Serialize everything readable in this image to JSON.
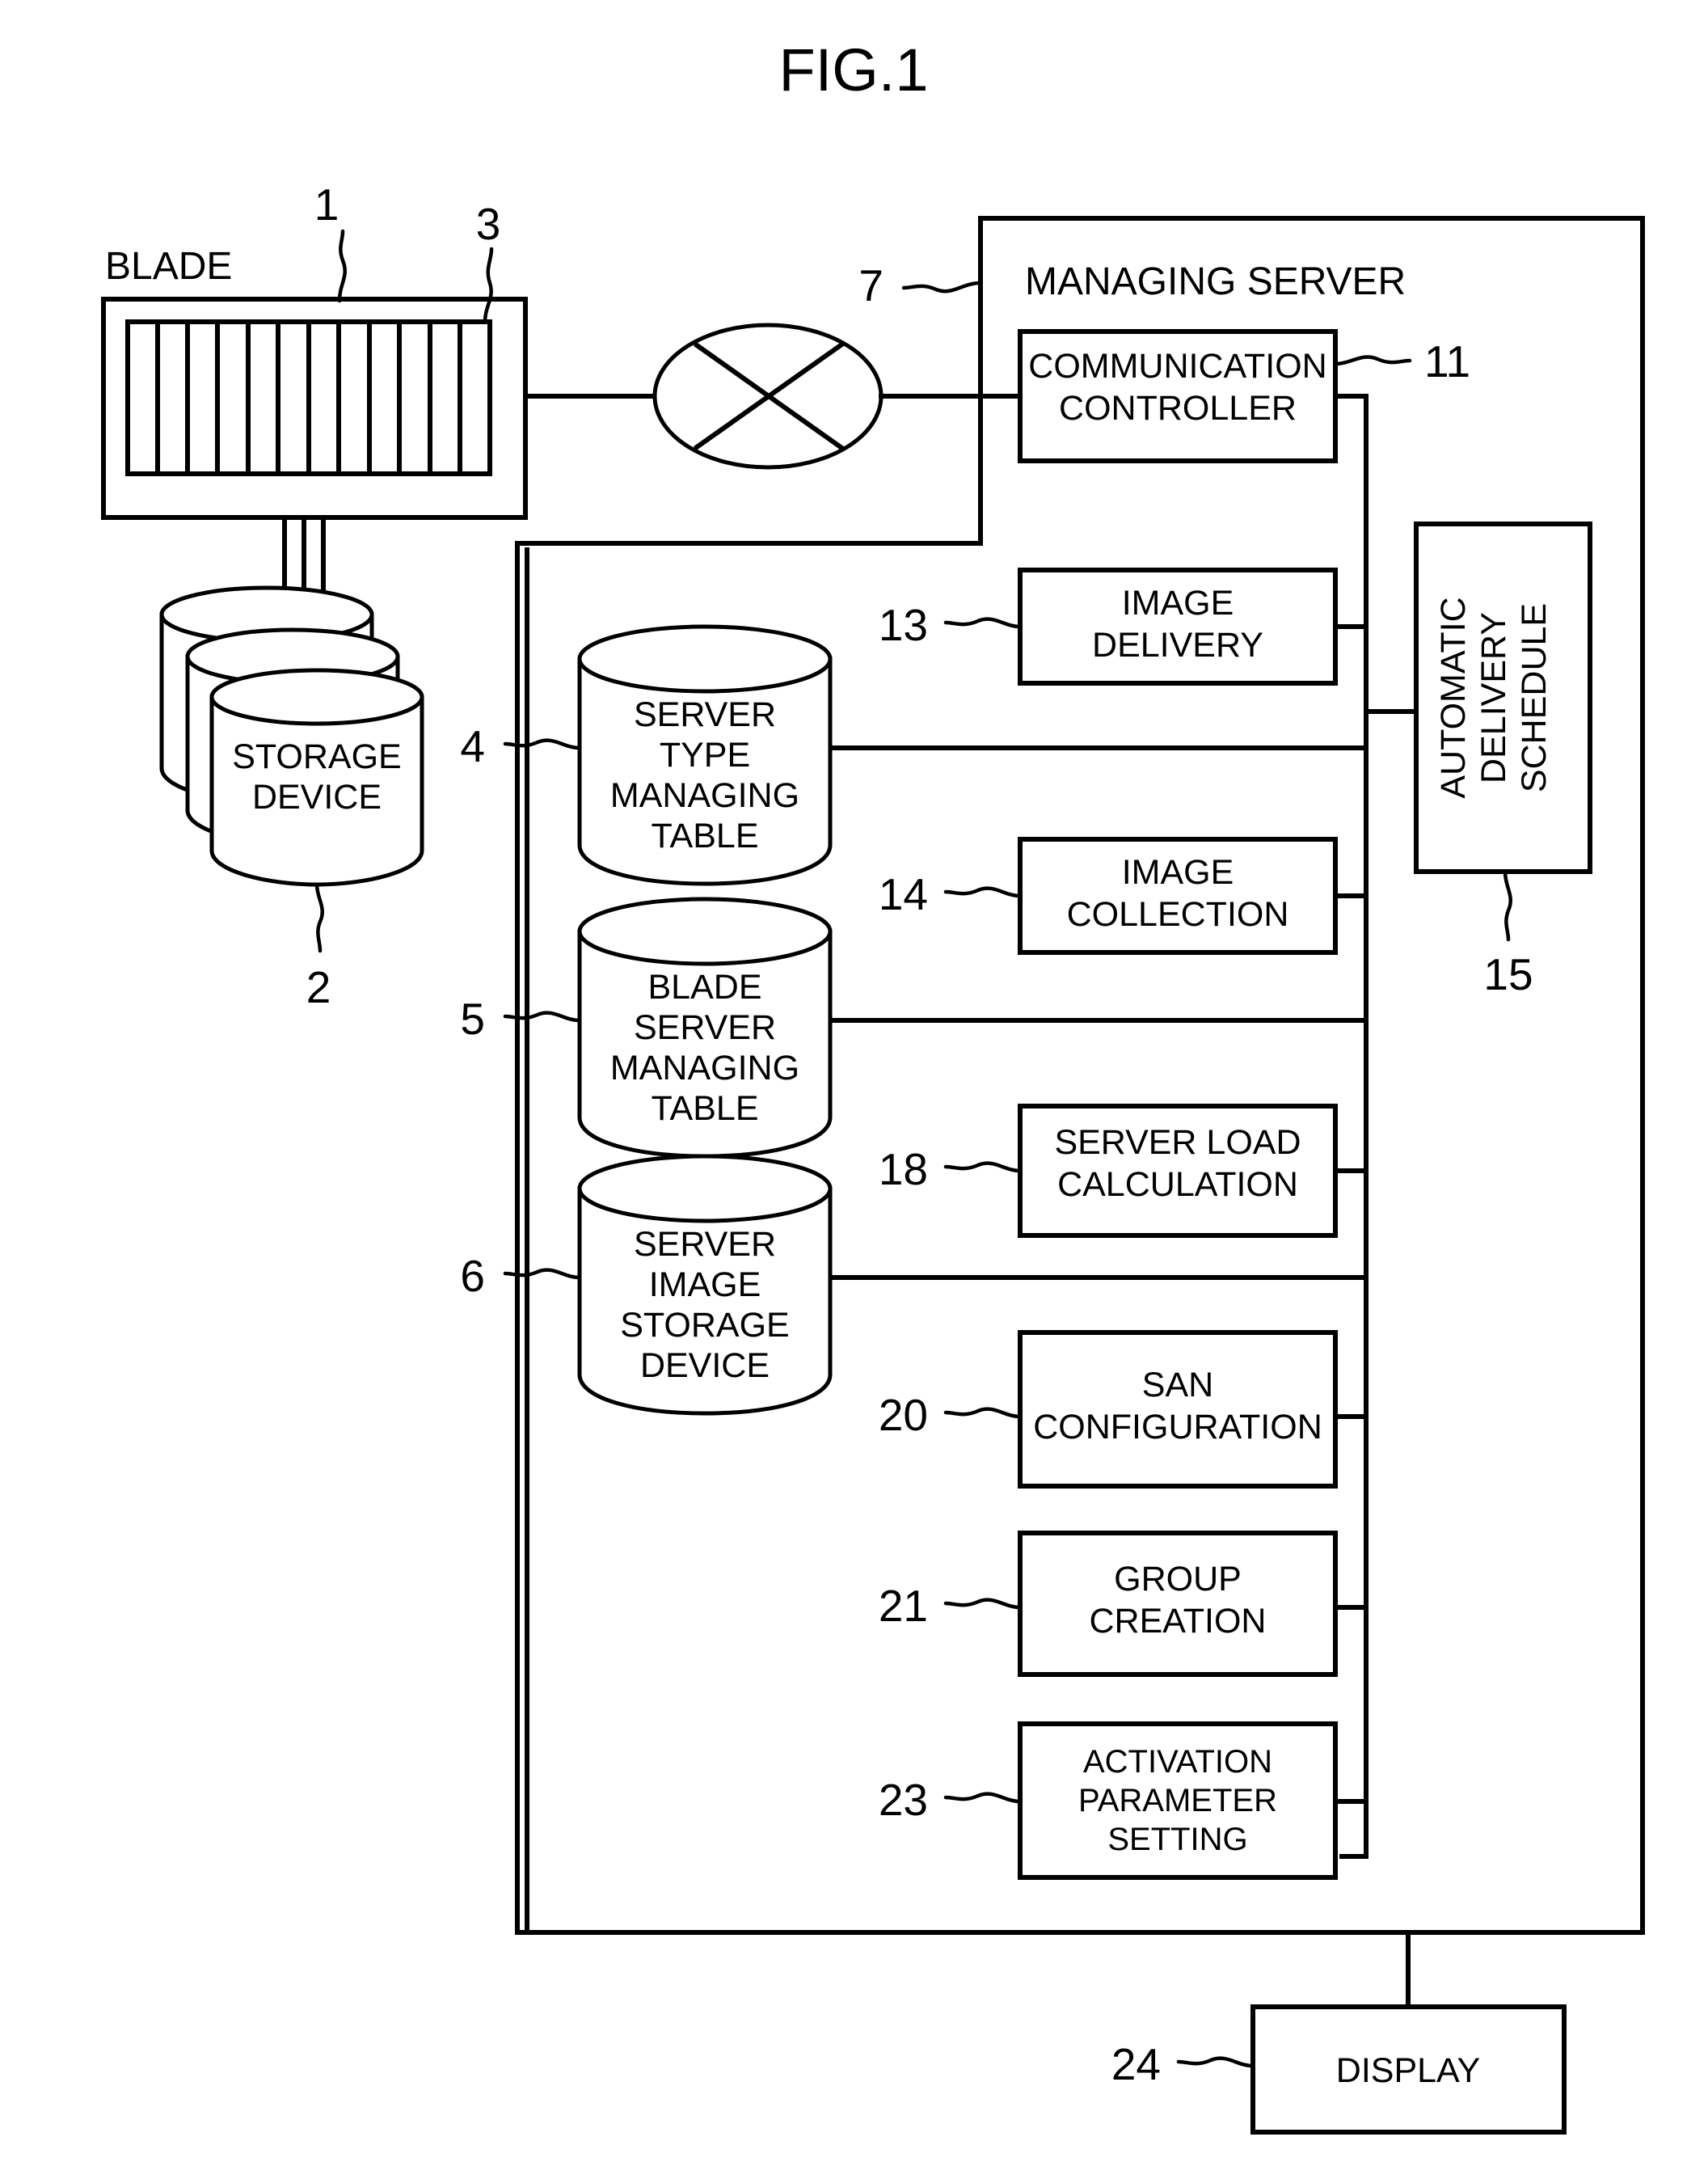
{
  "figure": {
    "title": "FIG.1"
  },
  "blade": {
    "label": "BLADE",
    "ref_chassis": "1",
    "ref_slots": "3",
    "slot_count": 12
  },
  "storage": {
    "label_line1": "STORAGE",
    "label_line2": "DEVICE",
    "ref": "2"
  },
  "network": {
    "icon": "network-switch-icon"
  },
  "managing_server": {
    "title": "MANAGING SERVER",
    "ref": "7"
  },
  "tables": [
    {
      "ref": "4",
      "lines": [
        "SERVER",
        "TYPE",
        "MANAGING",
        "TABLE"
      ],
      "name": "server-type-managing-table"
    },
    {
      "ref": "5",
      "lines": [
        "BLADE",
        "SERVER",
        "MANAGING",
        "TABLE"
      ],
      "name": "blade-server-managing-table"
    },
    {
      "ref": "6",
      "lines": [
        "SERVER",
        "IMAGE",
        "STORAGE",
        "DEVICE"
      ],
      "name": "server-image-storage-device"
    }
  ],
  "modules": [
    {
      "ref": "11",
      "lines": [
        "COMMUNICATION",
        "CONTROLLER"
      ],
      "name": "communication-controller"
    },
    {
      "ref": "13",
      "lines": [
        "IMAGE",
        "DELIVERY"
      ],
      "name": "image-delivery"
    },
    {
      "ref": "14",
      "lines": [
        "IMAGE",
        "COLLECTION"
      ],
      "name": "image-collection"
    },
    {
      "ref": "18",
      "lines": [
        "SERVER LOAD",
        "CALCULATION"
      ],
      "name": "server-load-calculation"
    },
    {
      "ref": "20",
      "lines": [
        "SAN",
        "CONFIGURATION"
      ],
      "name": "san-configuration"
    },
    {
      "ref": "21",
      "lines": [
        "GROUP",
        "CREATION"
      ],
      "name": "group-creation"
    },
    {
      "ref": "23",
      "lines": [
        "ACTIVATION",
        "PARAMETER",
        "SETTING"
      ],
      "name": "activation-parameter-setting"
    }
  ],
  "schedule": {
    "ref": "15",
    "lines": [
      "AUTOMATIC",
      "DELIVERY",
      "SCHEDULE"
    ],
    "name": "automatic-delivery-schedule"
  },
  "display": {
    "ref": "24",
    "label": "DISPLAY",
    "name": "display"
  },
  "colors": {
    "ink": "#000000",
    "paper": "#ffffff"
  }
}
